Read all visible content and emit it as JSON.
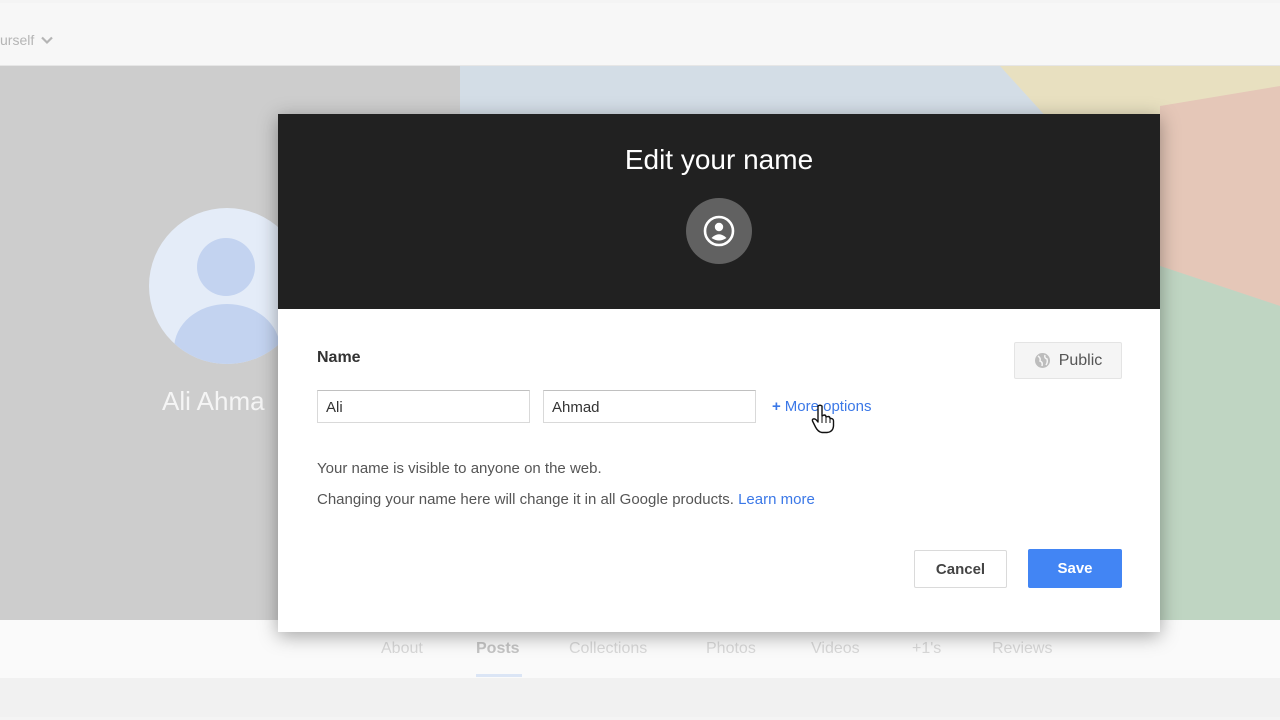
{
  "topbar": {
    "label": "urself"
  },
  "profile": {
    "name": "Ali Ahma"
  },
  "tabs": [
    {
      "label": "About"
    },
    {
      "label": "Posts"
    },
    {
      "label": "Collections"
    },
    {
      "label": "Photos"
    },
    {
      "label": "Videos"
    },
    {
      "label": "+1's"
    },
    {
      "label": "Reviews"
    }
  ],
  "dialog": {
    "title": "Edit your name",
    "name_label": "Name",
    "visibility_label": "Public",
    "first_name_value": "Ali",
    "last_name_value": "Ahmad",
    "more_options_plus": "+",
    "more_options_label": "More options",
    "info_visible": "Your name is visible to anyone on the web.",
    "info_change": "Changing your name here will change it in all Google products.",
    "learn_more": "Learn more",
    "cancel_label": "Cancel",
    "save_label": "Save"
  },
  "colors": {
    "accent": "#4285f4",
    "link": "#3b78e7",
    "header_bg": "#212121"
  },
  "icons": [
    "chevron-down-icon",
    "account-circle-icon",
    "globe-icon",
    "hand-cursor-icon"
  ]
}
